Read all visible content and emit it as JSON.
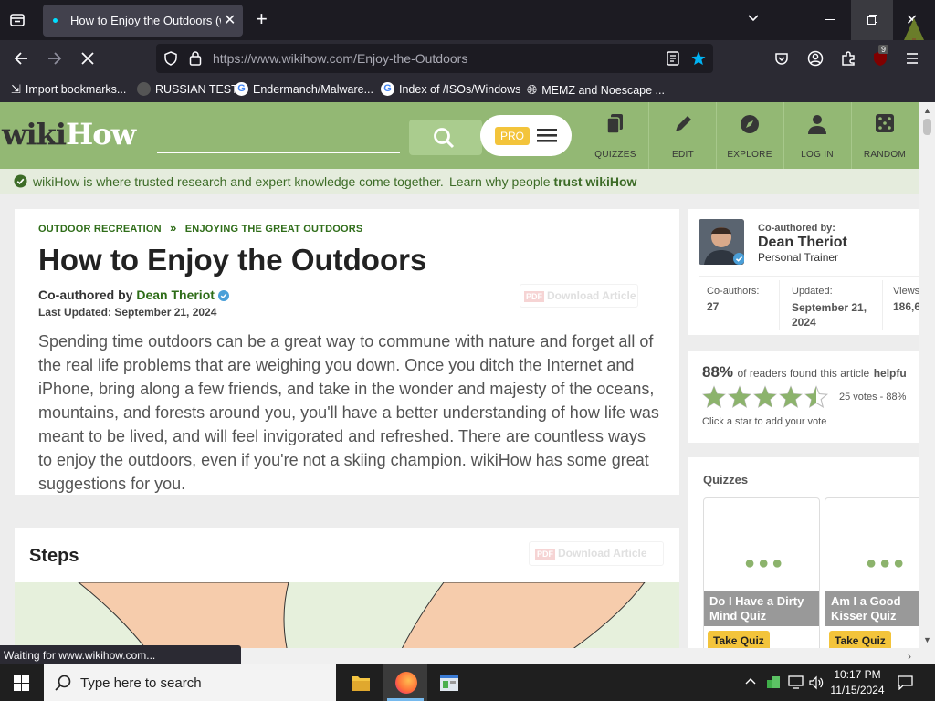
{
  "browser": {
    "tab_title": "How to Enjoy the Outdoors (wit",
    "url": "https://www.wikihow.com/Enjoy-the-Outdoors",
    "extension_badge": "9",
    "bookmarks": [
      {
        "label": "Import bookmarks...",
        "icon": "import-icon"
      },
      {
        "label": "RUSSIAN TEST",
        "icon": "site-icon"
      },
      {
        "label": "Endermanch/Malware...",
        "icon": "google-icon"
      },
      {
        "label": "Index of /ISOs/Windows",
        "icon": "google-icon"
      },
      {
        "label": "MEMZ and Noescape ...",
        "icon": "globe-icon"
      }
    ],
    "status": "Waiting for www.wikihow.com..."
  },
  "site": {
    "logo_wiki": "wiki",
    "logo_how": "How",
    "pro_badge": "PRO",
    "nav": [
      {
        "label": "QUIZZES",
        "icon": "quizzes-icon"
      },
      {
        "label": "EDIT",
        "icon": "pencil-icon"
      },
      {
        "label": "EXPLORE",
        "icon": "compass-icon"
      },
      {
        "label": "LOG IN",
        "icon": "user-icon"
      },
      {
        "label": "RANDOM",
        "icon": "dice-icon"
      }
    ],
    "trust_text": "wikiHow is where trusted research and expert knowledge come together.",
    "trust_link_prefix": "Learn why people",
    "trust_link_bold": "trust wikiHow"
  },
  "article": {
    "breadcrumb": [
      "OUTDOOR RECREATION",
      "ENJOYING THE GREAT OUTDOORS"
    ],
    "breadcrumb_sep": "»",
    "title": "How to Enjoy the Outdoors",
    "coauthored_prefix": "Co-authored by",
    "author": "Dean Theriot",
    "last_updated": "Last Updated: September 21, 2024",
    "download": "Download Article",
    "intro": "Spending time outdoors can be a great way to commune with nature and forget all of the real life problems that are weighing you down. Once you ditch the Internet and iPhone, bring along a few friends, and take in the wonder and majesty of the oceans, mountains, and forests around you, you'll have a better understanding of how life was meant to be lived, and will feel invigorated and refreshed. There are countless ways to enjoy the outdoors, even if you're not a skiing champion. wikiHow has some great suggestions for you.",
    "steps_heading": "Steps",
    "steps_download": "Download Article"
  },
  "sidebar": {
    "coauthored_label": "Co-authored by:",
    "author_name": "Dean Theriot",
    "author_role": "Personal Trainer",
    "stats": [
      {
        "label": "Co-authors:",
        "value": "27"
      },
      {
        "label": "Updated:",
        "value": "September 21, 2024"
      },
      {
        "label": "Views",
        "value": "186,6"
      }
    ],
    "rating_pct": "88%",
    "rating_text": "of readers found this article",
    "rating_bold": "helpfu",
    "stars_filled": 4.5,
    "votes": "25 votes - 88%",
    "rate_hint": "Click a star to add your vote",
    "quizzes_heading": "Quizzes",
    "quizzes": [
      {
        "title": "Do I Have a Dirty Mind Quiz",
        "button": "Take Quiz"
      },
      {
        "title": "Am I a Good Kisser Quiz",
        "button": "Take Quiz"
      }
    ]
  },
  "taskbar": {
    "search_placeholder": "Type here to search",
    "time": "10:17 PM",
    "date": "11/15/2024"
  },
  "colors": {
    "wikihow_green": "#93b874",
    "link_green": "#2e6d18",
    "star_green": "#8cb36c",
    "pro_yellow": "#f3c43b"
  }
}
